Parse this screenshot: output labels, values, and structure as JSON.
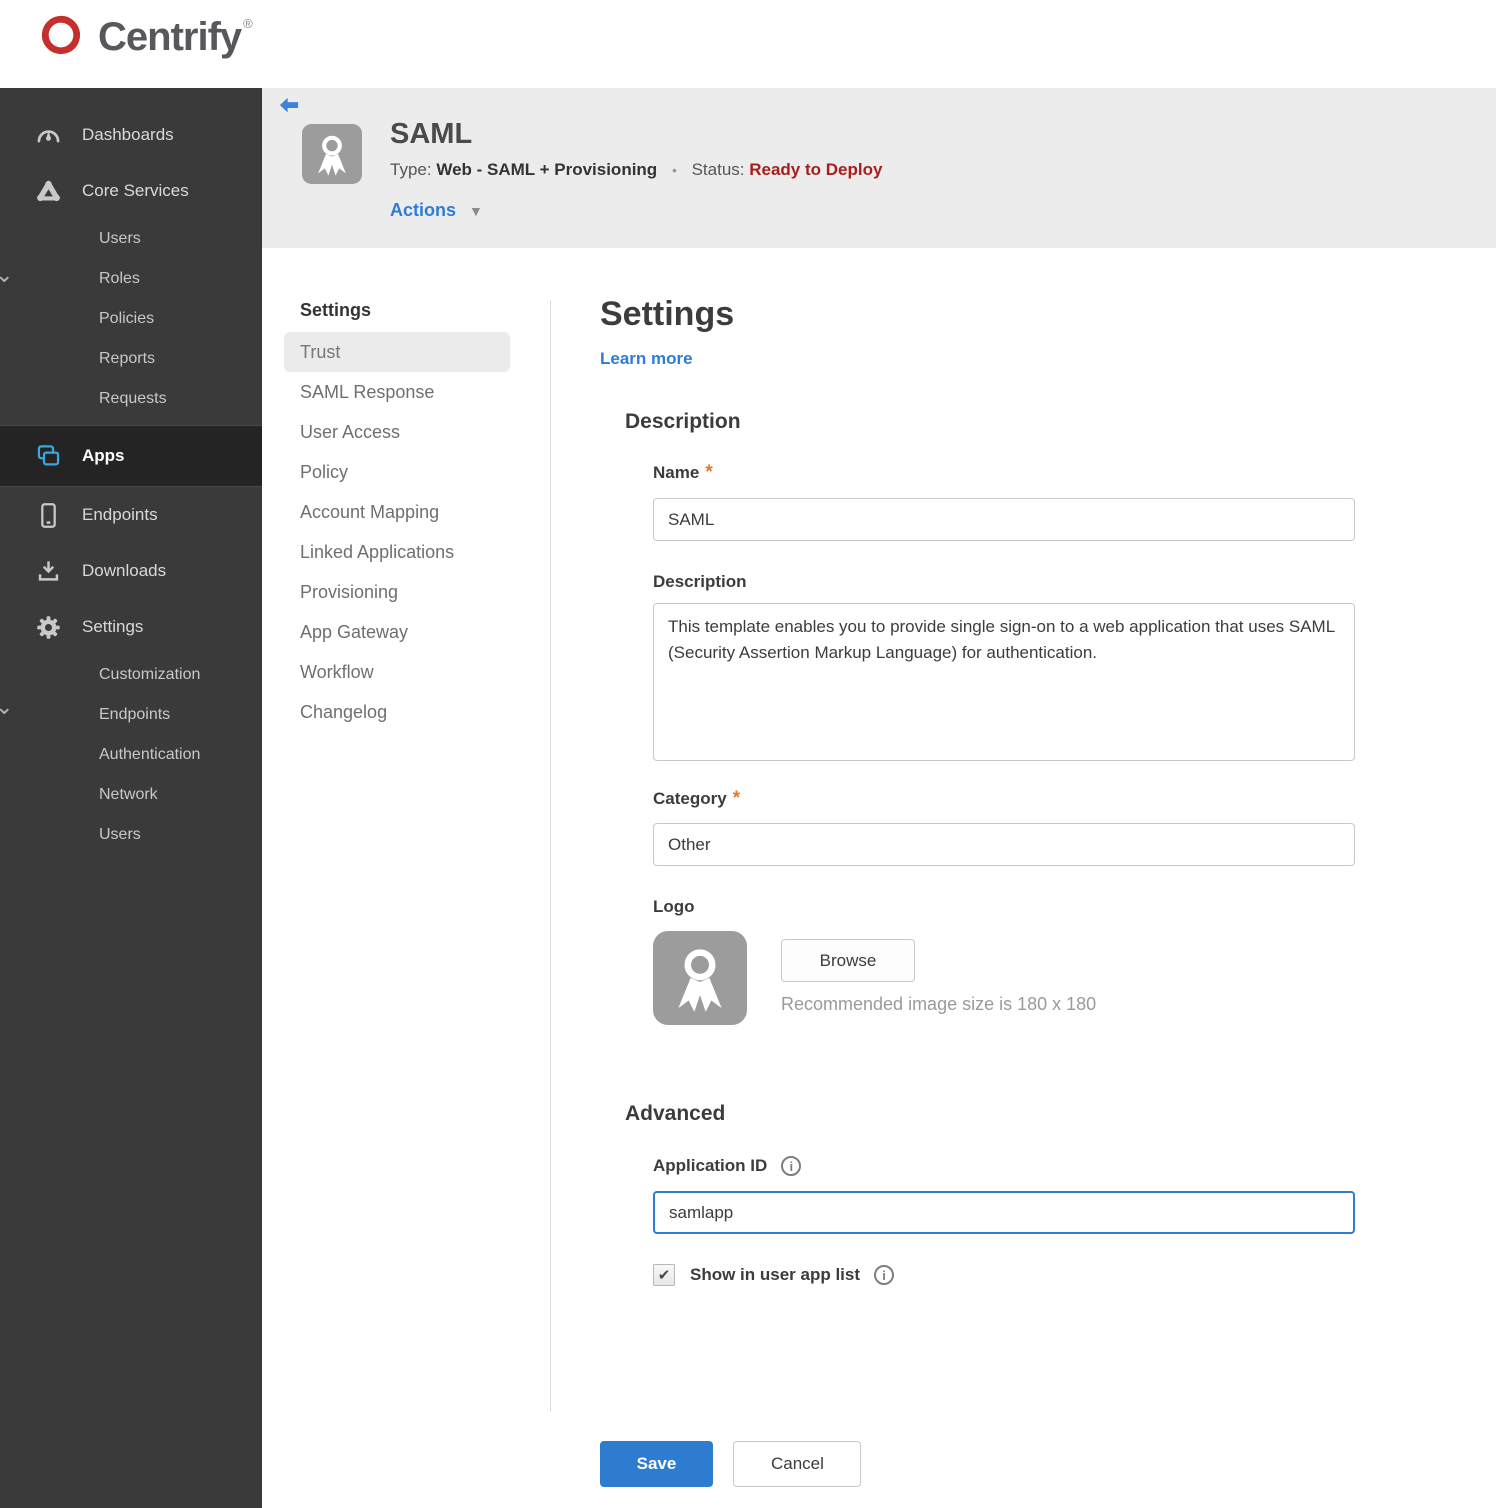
{
  "brand": {
    "name": "Centrify",
    "registered": "®"
  },
  "colors": {
    "accent_blue": "#2e7cd6",
    "status_red": "#a61e1e",
    "sidebar_bg": "#3a3a3a",
    "active_icon_blue": "#3ba7e0",
    "save_blue": "#2e7cd0",
    "logo_red": "#c6302c"
  },
  "icons": {
    "caret_down": "▼",
    "chevron_down": "⌄",
    "checkbox_check": "✔",
    "info": "i"
  },
  "sidebar": {
    "dashboards": "Dashboards",
    "core_services": "Core Services",
    "core_children": [
      "Users",
      "Roles",
      "Policies",
      "Reports",
      "Requests"
    ],
    "apps": "Apps",
    "endpoints": "Endpoints",
    "downloads": "Downloads",
    "settings": "Settings",
    "settings_children": [
      "Customization",
      "Endpoints",
      "Authentication",
      "Network",
      "Users"
    ]
  },
  "app_header": {
    "title": "SAML",
    "type_label": "Type:",
    "type_value": "Web - SAML + Provisioning",
    "separator": "•",
    "status_label": "Status:",
    "status_value": "Ready to Deploy",
    "actions_label": "Actions"
  },
  "subnav": {
    "header": "Settings",
    "active": "Trust",
    "items": [
      "Trust",
      "SAML Response",
      "User Access",
      "Policy",
      "Account Mapping",
      "Linked Applications",
      "Provisioning",
      "App Gateway",
      "Workflow",
      "Changelog"
    ]
  },
  "main": {
    "title": "Settings",
    "learn_more": "Learn more",
    "required_marker": "*",
    "description_section": "Description",
    "name_label": "Name",
    "name_value": "SAML",
    "description_label": "Description",
    "description_value": "This template enables you to provide single sign-on to a web application that uses SAML (Security Assertion Markup Language) for authentication.",
    "category_label": "Category",
    "category_value": "Other",
    "logo_label": "Logo",
    "browse_label": "Browse",
    "logo_hint": "Recommended image size is 180 x 180",
    "advanced_section": "Advanced",
    "app_id_label": "Application ID",
    "app_id_value": "samlapp",
    "show_in_list_label": "Show in user app list",
    "save_label": "Save",
    "cancel_label": "Cancel"
  }
}
